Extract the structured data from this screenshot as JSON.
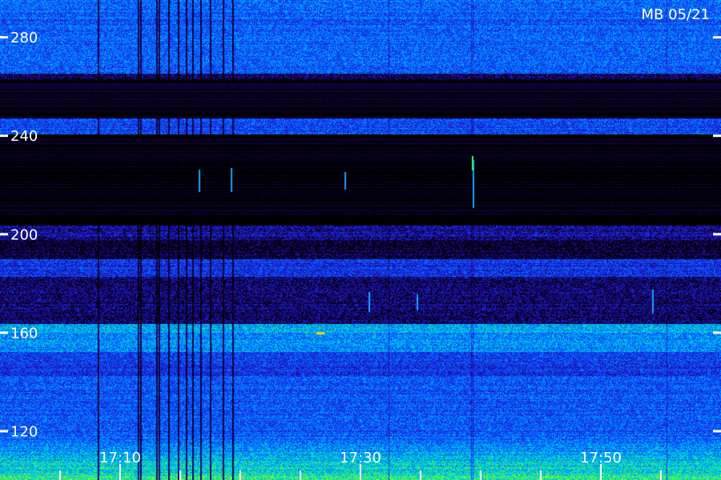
{
  "chart_data": {
    "type": "heatmap",
    "title": "MB 05/21",
    "y_ticks": [
      120,
      160,
      200,
      240,
      280
    ],
    "x_ticks": [
      "17:10",
      "17:30",
      "17:50"
    ],
    "ylim": [
      100,
      295
    ]
  }
}
